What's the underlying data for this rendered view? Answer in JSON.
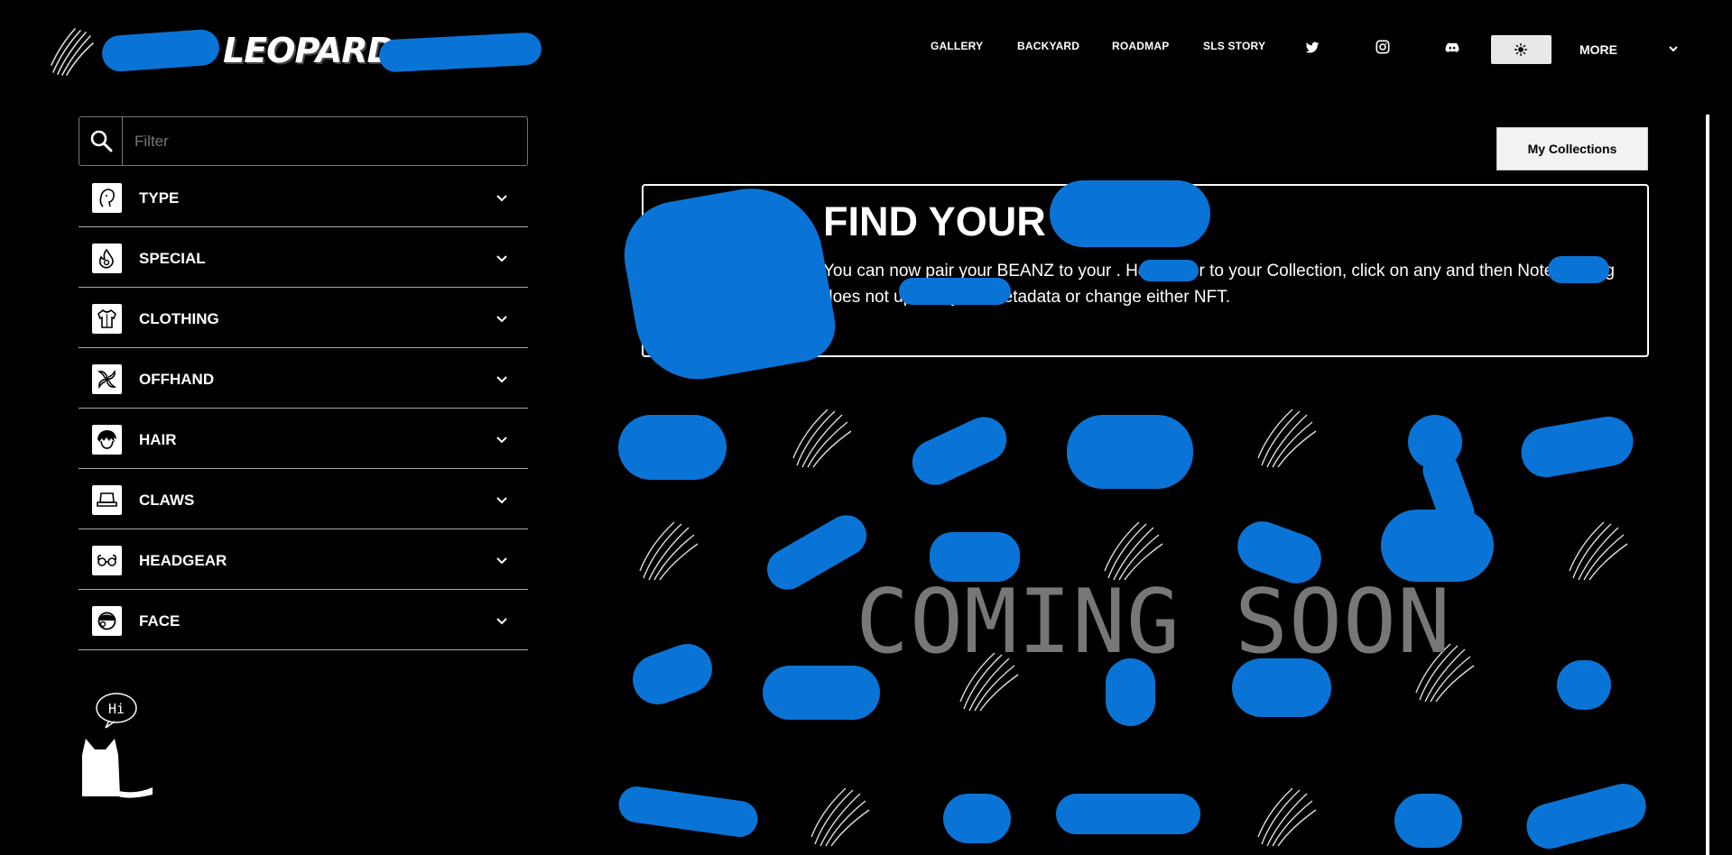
{
  "header": {
    "brand": "LEOPARD",
    "nav": [
      {
        "label": "GALLERY"
      },
      {
        "label": "BACKYARD"
      },
      {
        "label": "ROADMAP"
      },
      {
        "label": "SLS STORY"
      }
    ],
    "social_icons": [
      "twitter-icon",
      "instagram-icon",
      "discord-icon"
    ],
    "theme_icon": "sun-icon",
    "more_label": "MORE"
  },
  "sidebar": {
    "filter_placeholder": "Filter",
    "categories": [
      {
        "label": "TYPE",
        "icon": "type-icon"
      },
      {
        "label": "SPECIAL",
        "icon": "flame-icon"
      },
      {
        "label": "CLOTHING",
        "icon": "shirt-icon"
      },
      {
        "label": "OFFHAND",
        "icon": "offhand-icon"
      },
      {
        "label": "HAIR",
        "icon": "hair-icon"
      },
      {
        "label": "CLAWS",
        "icon": "claws-icon"
      },
      {
        "label": "HEADGEAR",
        "icon": "headgear-icon"
      },
      {
        "label": "FACE",
        "icon": "face-icon"
      }
    ],
    "mascot_text": "Hi"
  },
  "main": {
    "collections_button": "My Collections",
    "banner": {
      "title": "FIND YOUR",
      "text": "You can now pair your BEANZ to your . Head over to your Collection, click on any and then Note: pairing does not update your metadata or change either NFT."
    },
    "coming_soon": "COMING SOON"
  },
  "colors": {
    "background": "#000000",
    "redaction": "#0a74d6",
    "coming_soon": "#777777"
  }
}
